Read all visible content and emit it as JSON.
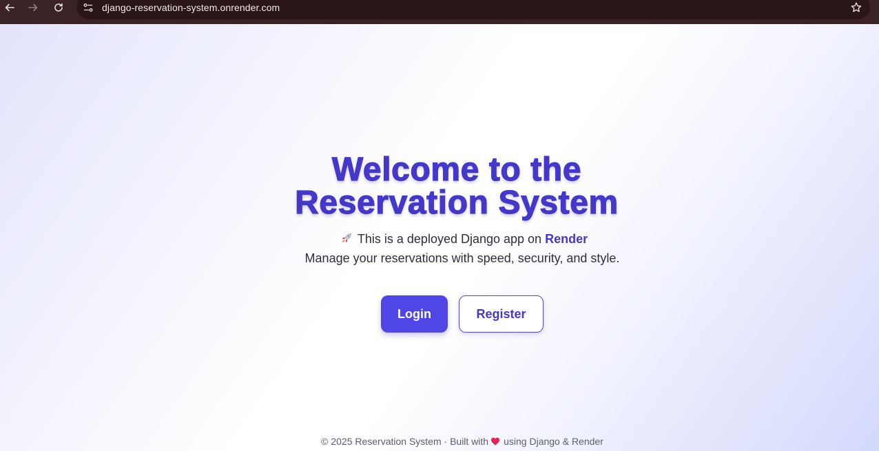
{
  "browser": {
    "url": "django-reservation-system.onrender.com"
  },
  "hero": {
    "title_line1": "Welcome to the",
    "title_line2": "Reservation System",
    "tagline_prefix": "This is a deployed Django app on",
    "tagline_link": "Render",
    "subtagline": "Manage your reservations with speed, security, and style."
  },
  "actions": {
    "login_label": "Login",
    "register_label": "Register"
  },
  "footer": {
    "prefix": "© 2025 Reservation System · Built with",
    "suffix": "using Django & Render"
  },
  "colors": {
    "brand": "#4338ca",
    "button_primary": "#4f46e5",
    "browser_bar": "#3a2226"
  },
  "icons": {
    "tagline": "rocket-icon",
    "footer": "heart-icon"
  }
}
